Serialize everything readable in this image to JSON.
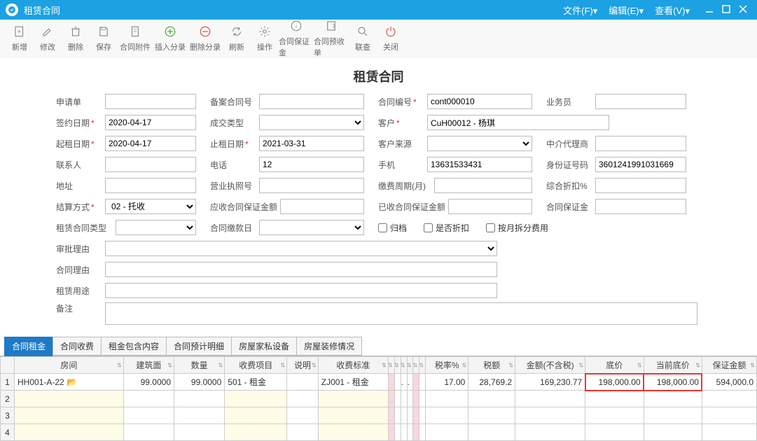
{
  "titlebar": {
    "title": "租赁合同",
    "menus": [
      "文件(F)▾",
      "编辑(E)▾",
      "查看(V)▾"
    ]
  },
  "toolbar": {
    "items": [
      {
        "name": "new-btn",
        "label": "新增"
      },
      {
        "name": "modify-btn",
        "label": "修改"
      },
      {
        "name": "delete-btn",
        "label": "删除"
      },
      {
        "name": "save-btn",
        "label": "保存"
      },
      {
        "name": "attach-btn",
        "label": "合同附件"
      },
      {
        "name": "insert-entry-btn",
        "label": "插入分录"
      },
      {
        "name": "delete-entry-btn",
        "label": "删除分录"
      },
      {
        "name": "refresh-btn",
        "label": "刷新"
      },
      {
        "name": "ops-btn",
        "label": "操作"
      },
      {
        "name": "deposit-btn",
        "label": "合同保证金"
      },
      {
        "name": "prepay-btn",
        "label": "合同预收单"
      },
      {
        "name": "linkquery-btn",
        "label": "联查"
      },
      {
        "name": "close-btn",
        "label": "关闭"
      }
    ]
  },
  "form": {
    "title": "租赁合同",
    "labels": {
      "apply": "申请单",
      "record_no": "备案合同号",
      "contract_no": "合同编号",
      "sales": "业务员",
      "sign_date": "签约日期",
      "deal_type": "成交类型",
      "customer": "客户",
      "start_date": "起租日期",
      "end_date": "止租日期",
      "cust_src": "客户来源",
      "agent": "中介代理商",
      "contact": "联系人",
      "phone": "电话",
      "mobile": "手机",
      "idno": "身份证号码",
      "address": "地址",
      "biz_lic": "营业执照号",
      "fee_cycle": "缴费周期(月)",
      "discount": "综合折扣%",
      "settle": "结算方式",
      "recv_deposit": "应收合同保证金额",
      "paid_deposit": "已收合同保证金额",
      "deposit": "合同保证金",
      "lease_type": "租赁合同类型",
      "fee_date": "合同缴款日",
      "archive": "归档",
      "is_discount": "是否折扣",
      "split_month": "按月拆分费用",
      "approve_reason": "审批理由",
      "contract_reason": "合同理由",
      "lease_use": "租赁用途",
      "remark": "备注"
    },
    "values": {
      "contract_no": "cont000010",
      "sign_date": "2020-04-17",
      "customer": "CuH00012 - 杨琪",
      "start_date": "2020-04-17",
      "end_date": "2021-03-31",
      "phone": "12",
      "mobile": "13631533431",
      "idno": "3601241991031669",
      "settle": "02 - 托收"
    }
  },
  "tabs": [
    "合同租金",
    "合同收费",
    "租金包含内容",
    "合同预计明细",
    "房屋家私设备",
    "房屋装修情况"
  ],
  "grid": {
    "headers": [
      "",
      "房间",
      "建筑面",
      "数量",
      "收费项目",
      "说明",
      "收费标准",
      "",
      "",
      "",
      "",
      "",
      "",
      "税率%",
      "税额",
      "金额(不含税)",
      "底价",
      "当前底价",
      "保证金额"
    ],
    "rows": [
      {
        "room": "HH001-A-22",
        "area": "99.0000",
        "qty": "99.0000",
        "item": "501 - 租金",
        "note": "",
        "std": "ZJ001 - 租金",
        "rate": "17.00",
        "tax": "28,769.2",
        "amt": "169,230.77",
        "base": "198,000.00",
        "curbase": "198,000.00",
        "guar": "594,000.0"
      }
    ],
    "empty_rows": 3
  }
}
